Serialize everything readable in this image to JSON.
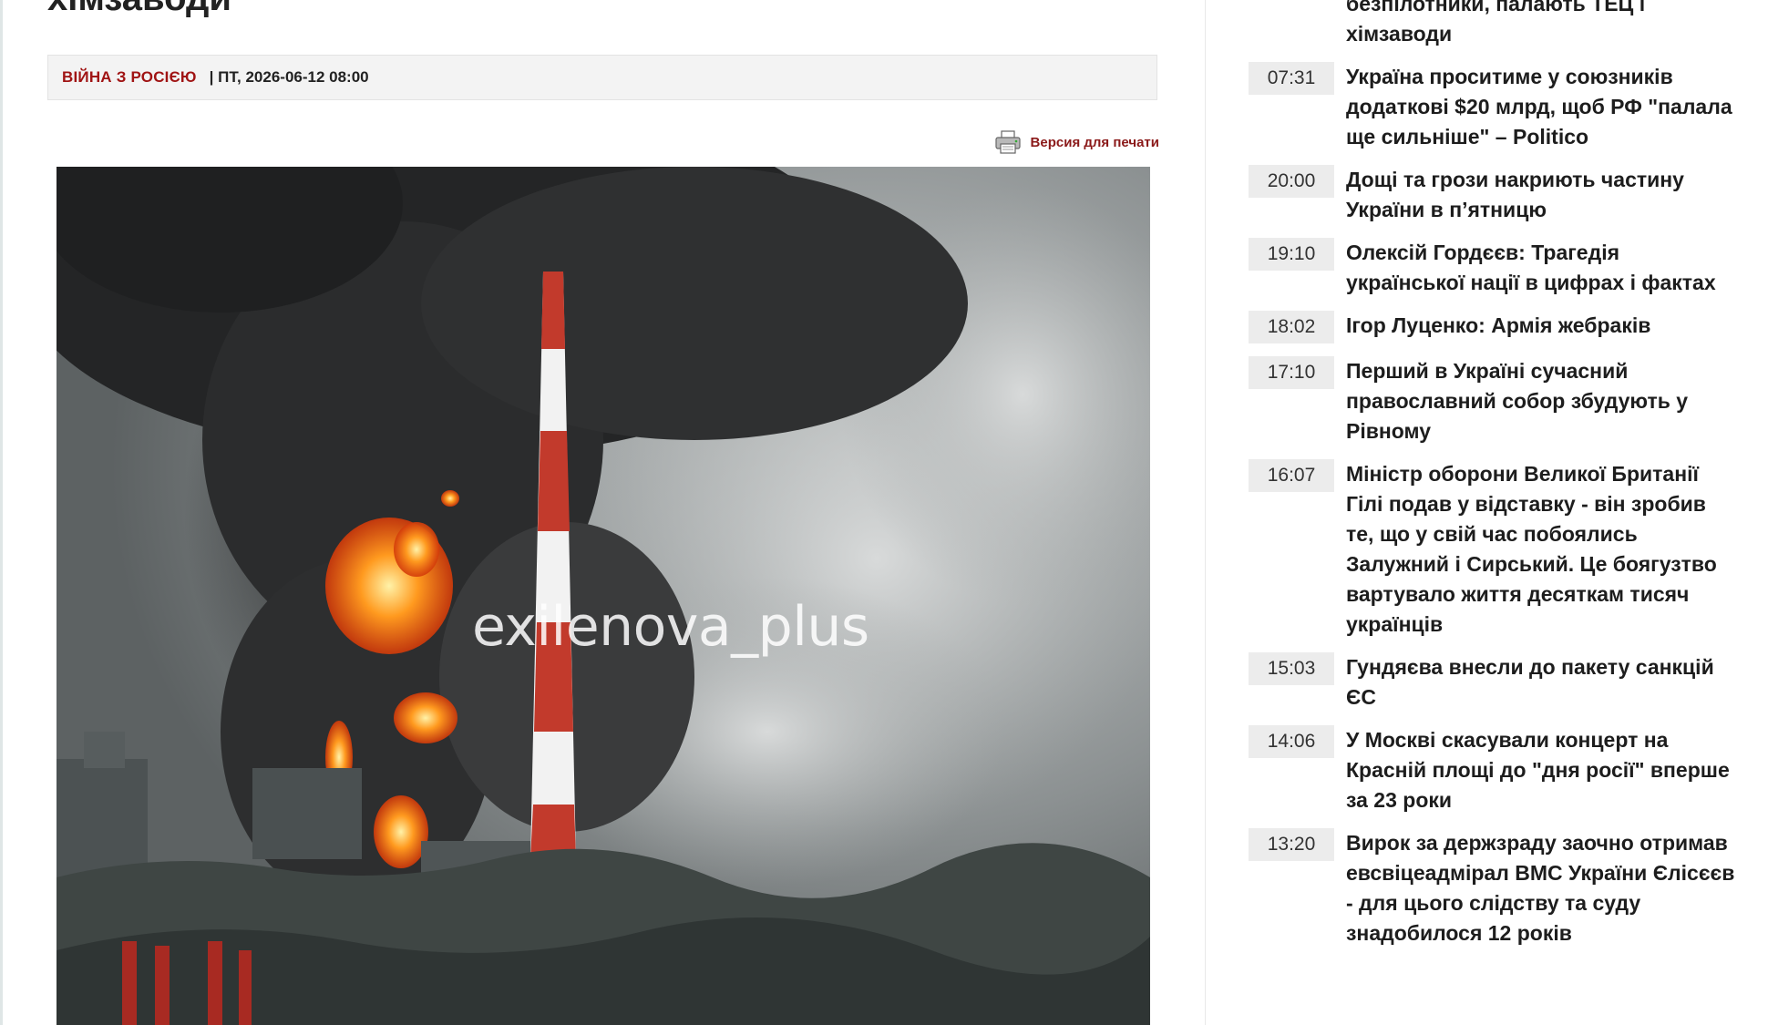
{
  "article": {
    "headline": "хімзаводи",
    "category": "ВІЙНА З РОСІЄЮ",
    "date": "| ПТ, 2026-06-12 08:00",
    "print_label": "Версия для печати",
    "photo_watermark": "exilenova_plus"
  },
  "sidebar": {
    "items": [
      {
        "time": "",
        "title": "безпілотники, палають ТЕЦ і хімзаводи"
      },
      {
        "time": "07:31",
        "title": "Україна проситиме у союзників додаткові $20 млрд, щоб РФ \"палала ще сильніше\" – Politico"
      },
      {
        "time": "20:00",
        "title": "Дощі та грози накриють частину України в п’ятницю"
      },
      {
        "time": "19:10",
        "title": "Олексій Гордєєв: Трагедія української нації в цифрах і фактах"
      },
      {
        "time": "18:02",
        "title": "Ігор Луценко: Армія жебраків"
      },
      {
        "time": "17:10",
        "title": "Перший в Україні сучасний православний собор збудують у Рівному"
      },
      {
        "time": "16:07",
        "title": "Міністр оборони Великої Британії Гілі подав у відставку - він зробив те, що у свій час побоялись Залужний і Сирський. Це боягузтво вартувало життя десяткам тисяч українців"
      },
      {
        "time": "15:03",
        "title": "Гундяєва внесли до пакету санкцій ЄС"
      },
      {
        "time": "14:06",
        "title": "У Москві скасували концерт на Красній площі до \"дня росії\" вперше за 23 роки"
      },
      {
        "time": "13:20",
        "title": "Вирок за держзраду заочно отримав евсвіцеадмірал ВМС України Єлісєєв - для цього слідству та суду знадобилося 12 років"
      }
    ]
  }
}
